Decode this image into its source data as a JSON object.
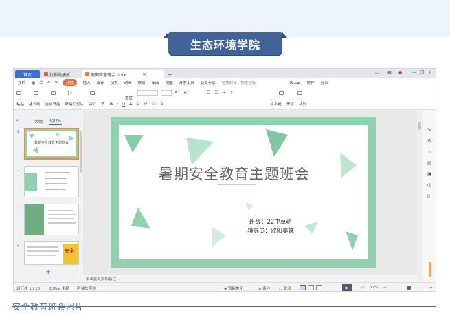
{
  "banner": {
    "title": "生态环境学院"
  },
  "window": {
    "tabs": {
      "home": "首页",
      "template": "找稻壳模板",
      "document": "假期安全班会.pptx"
    },
    "menu": [
      "文件",
      "开始",
      "插入",
      "设计",
      "切换",
      "动画",
      "放映",
      "审阅",
      "视图",
      "开发工具",
      "会员专享",
      "查找命令、搜索模板",
      "未上云",
      "协作",
      "分享"
    ],
    "menu_active_index": 1,
    "toolbar_row1": [
      "粘贴",
      "格式刷",
      "当前开始",
      "新建幻灯片",
      "版式",
      "节",
      "重置",
      "文本框",
      "形状",
      "排列"
    ],
    "toolbar_glyphs": [
      "B",
      "I",
      "U",
      "S",
      "A",
      "X²",
      "X₂",
      "A"
    ]
  },
  "sidebar": {
    "tabs": [
      "大纲",
      "幻灯片"
    ],
    "active_tab": 1,
    "slide_numbers": [
      "1",
      "2",
      "3",
      "4"
    ],
    "thumb1_title": "暑期安全教育主题班会",
    "thumb4_text": "安全"
  },
  "slide": {
    "title": "暑期安全教育主题班会",
    "class_info": "班级：22中草药",
    "advisor": "辅导员：欧阳蓁姝",
    "accent_color": "#8fd2b0"
  },
  "notes_placeholder": "单击此处添加备注",
  "status": {
    "slide_count": "幻灯片 1 / 10",
    "theme": "Office 主题",
    "font_missing": "缺失字体",
    "beautify": "智能美化",
    "notes": "备注",
    "comments": "批注",
    "zoom": "62%"
  },
  "caption": "安全教育班会照片"
}
